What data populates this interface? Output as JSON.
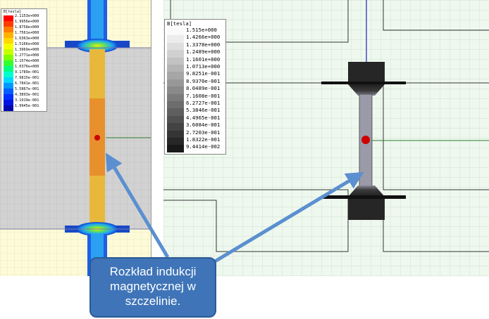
{
  "legend_left": {
    "title": "B[tesla]",
    "values": [
      "2.1153e+000",
      "1.9956e+000",
      "1.8758e+000",
      "1.7561e+000",
      "1.6363e+000",
      "1.5166e+000",
      "1.3969e+000",
      "1.2771e+000",
      "1.1574e+000",
      "1.0376e+000",
      "9.1789e-001",
      "7.9815e-001",
      "6.7841e-001",
      "5.5867e-001",
      "4.3893e-001",
      "3.1919e-001",
      "1.9945e-001"
    ],
    "colors": [
      "#ff0000",
      "#ff3c00",
      "#ff7c00",
      "#ffb000",
      "#ffd800",
      "#f4ff00",
      "#c8ff00",
      "#80ff00",
      "#34ff30",
      "#00ff80",
      "#00ffcc",
      "#00d8ff",
      "#0098ff",
      "#0060ff",
      "#0030ff",
      "#0014e0",
      "#0008b0"
    ]
  },
  "legend_right": {
    "title": "B[tesla]",
    "values": [
      "1.515e+000",
      "1.4266e+000",
      "1.3378e+000",
      "1.2489e+000",
      "1.1601e+000",
      "1.0713e+000",
      "9.8251e-001",
      "8.9370e-001",
      "8.0489e-001",
      "7.1608e-001",
      "6.2727e-001",
      "5.3846e-001",
      "4.4965e-001",
      "3.6084e-001",
      "2.7203e-001",
      "1.8322e-001",
      "9.4414e-002"
    ]
  },
  "callout": {
    "lines": [
      "Rozkład indukcji",
      "magnetycznej w",
      "szczelinie."
    ]
  },
  "colors": {
    "callout_fill": "#3f74b8",
    "arrow": "#5b8fd0",
    "left_background": "#fdfbd8",
    "right_background": "#eef8ee",
    "core_gray": "#d4d4d4",
    "gap_orange": "#e8902c",
    "gap_yellow": "#e8b83c",
    "pole_dark": "#222222",
    "gap_gray": "#9a9aa8",
    "point_red": "#cc0000"
  }
}
